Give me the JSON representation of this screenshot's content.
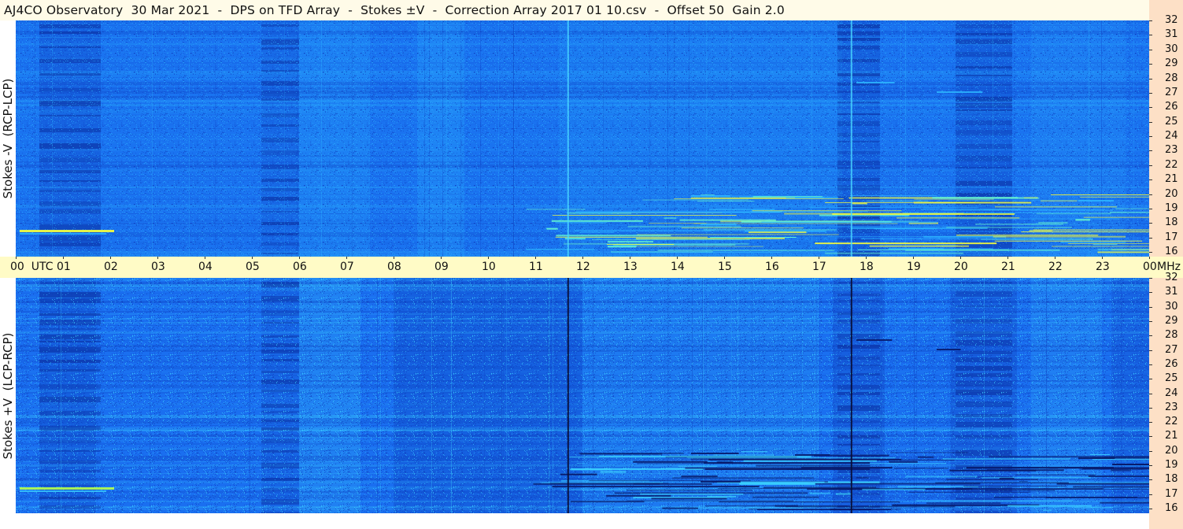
{
  "title": "AJ4CO Observatory  30 Mar 2021  -  DPS on TFD Array  -  Stokes ±V  -  Correction Array 2017 01 10.csv  -  Offset 50  Gain 2.0",
  "chart_data": [
    {
      "type": "heatmap",
      "ylabel": "Stokes -V  (RCP-LCP)",
      "x_range": [
        0,
        24
      ],
      "y_range": [
        16,
        32
      ],
      "y_ticks": [
        "32",
        "31",
        "30",
        "29",
        "28",
        "27",
        "26",
        "25",
        "24",
        "23",
        "22",
        "21",
        "20",
        "19",
        "18",
        "17",
        "16"
      ],
      "colors": {
        "background": "#1a73f0",
        "dark": "#0d3fc0",
        "light": "#2cb4ff",
        "hot": "#f8ff3a"
      }
    },
    {
      "type": "heatmap",
      "ylabel": "Stokes +V  (LCP-RCP)",
      "x_range": [
        0,
        24
      ],
      "y_range": [
        16,
        32
      ],
      "y_ticks": [
        "32",
        "31",
        "30",
        "29",
        "28",
        "27",
        "26",
        "25",
        "24",
        "23",
        "22",
        "21",
        "20",
        "19",
        "18",
        "17",
        "16"
      ],
      "colors": {
        "background": "#1a6ff0",
        "dark": "#0c3ab8",
        "light": "#3bd0ff",
        "hot": "#b8ff4a"
      }
    }
  ],
  "x_axis": {
    "ticks": [
      "00  UTC",
      "01",
      "02",
      "03",
      "04",
      "05",
      "06",
      "07",
      "08",
      "09",
      "10",
      "11",
      "12",
      "13",
      "14",
      "15",
      "16",
      "17",
      "18",
      "19",
      "20",
      "21",
      "22",
      "23",
      "00"
    ],
    "unit": "MHz"
  }
}
